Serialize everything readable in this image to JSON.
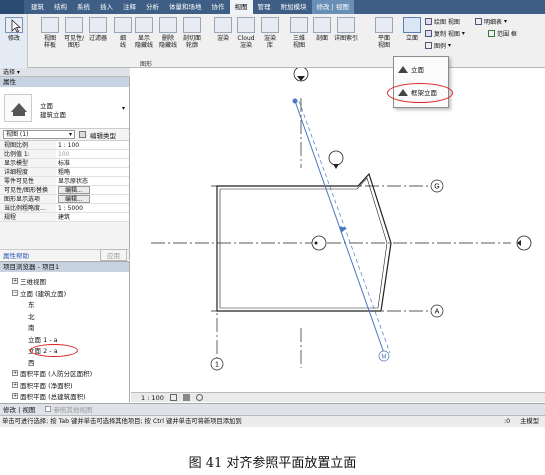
{
  "tabs": [
    "建筑",
    "结构",
    "系统",
    "插入",
    "注释",
    "分析",
    "体量和场地",
    "协作",
    "视图",
    "管理",
    "附加模块",
    "修改 | 视图"
  ],
  "active_tab_index": 8,
  "ribbon": {
    "modify": "修改",
    "buttons": [
      {
        "label": "视图\n样板"
      },
      {
        "label": "可见性/\n图形"
      },
      {
        "label": "过滤器"
      },
      {
        "label": "细\n线"
      },
      {
        "label": "显示\n隐藏线"
      },
      {
        "label": "删除\n隐藏线"
      },
      {
        "label": "剖切面\n轮廓"
      },
      {
        "label": "渲染"
      },
      {
        "label": "Cloud\n渲染"
      },
      {
        "label": "渲染\n库"
      },
      {
        "label": "三维\n视图"
      },
      {
        "label": "剖面"
      },
      {
        "label": "详图索引"
      },
      {
        "label": "平面\n视图"
      },
      {
        "label": "立面"
      }
    ],
    "panel_graphics": "图形",
    "right_items": [
      "绘图 视图",
      "明细表",
      "复制 视图",
      "范围 框",
      "图例"
    ],
    "selection_label": "选择 ▾"
  },
  "dropdown": {
    "items": [
      "立面",
      "框架立面"
    ]
  },
  "properties": {
    "title": "属性",
    "type_name_1": "立面",
    "type_name_2": "建筑立面",
    "filter": "视图 (1)",
    "edit_type": "编辑类型",
    "rows": [
      {
        "k": "视图比例",
        "v": "1 : 100"
      },
      {
        "k": "比例值 1:",
        "v": "100",
        "dim": true
      },
      {
        "k": "显示模型",
        "v": "标准"
      },
      {
        "k": "详细程度",
        "v": "粗略"
      },
      {
        "k": "零件可见性",
        "v": "显示原状态"
      },
      {
        "k": "可见性/图形替换",
        "v": "编辑...",
        "btn": true
      },
      {
        "k": "图形显示选项",
        "v": "编辑...",
        "btn": true
      },
      {
        "k": "当比例粗略度...",
        "v": "1 : 5000"
      },
      {
        "k": "规程",
        "v": "建筑"
      }
    ],
    "help": "属性帮助",
    "apply": "应用"
  },
  "browser": {
    "title": "项目浏览器 - 项目1",
    "items": [
      {
        "label": "三维视图",
        "pm": "+",
        "indent": 1
      },
      {
        "label": "立面 (建筑立面)",
        "pm": "−",
        "indent": 1
      },
      {
        "label": "东",
        "indent": 3
      },
      {
        "label": "北",
        "indent": 3
      },
      {
        "label": "南",
        "indent": 3
      },
      {
        "label": "立面 1 - a",
        "indent": 3
      },
      {
        "label": "立面 2 - a",
        "indent": 3
      },
      {
        "label": "西",
        "indent": 3
      },
      {
        "label": "面积平面 (人防分区面积)",
        "pm": "+",
        "indent": 1
      },
      {
        "label": "面积平面 (净面积)",
        "pm": "+",
        "indent": 1
      },
      {
        "label": "面积平面 (总建筑面积)",
        "pm": "+",
        "indent": 1
      }
    ]
  },
  "view": {
    "grid_labels": [
      "G",
      "A",
      "1",
      "M"
    ],
    "scale": "1 : 100"
  },
  "options_bar": {
    "left": "修改 | 视图",
    "checkbox": "参照其他视图"
  },
  "status": {
    "text": "单击可进行选择; 按 Tab 键并单击可选择其他项目; 按 Ctrl 键并单击可将新项目添加到",
    "zoom": ":0",
    "model": "主模型"
  },
  "caption": "图 41  对齐参照平面放置立面",
  "colors": {
    "tab_bg": "#3e5e86",
    "highlight": "#e02020",
    "ref_plane": "#4a78c4"
  }
}
